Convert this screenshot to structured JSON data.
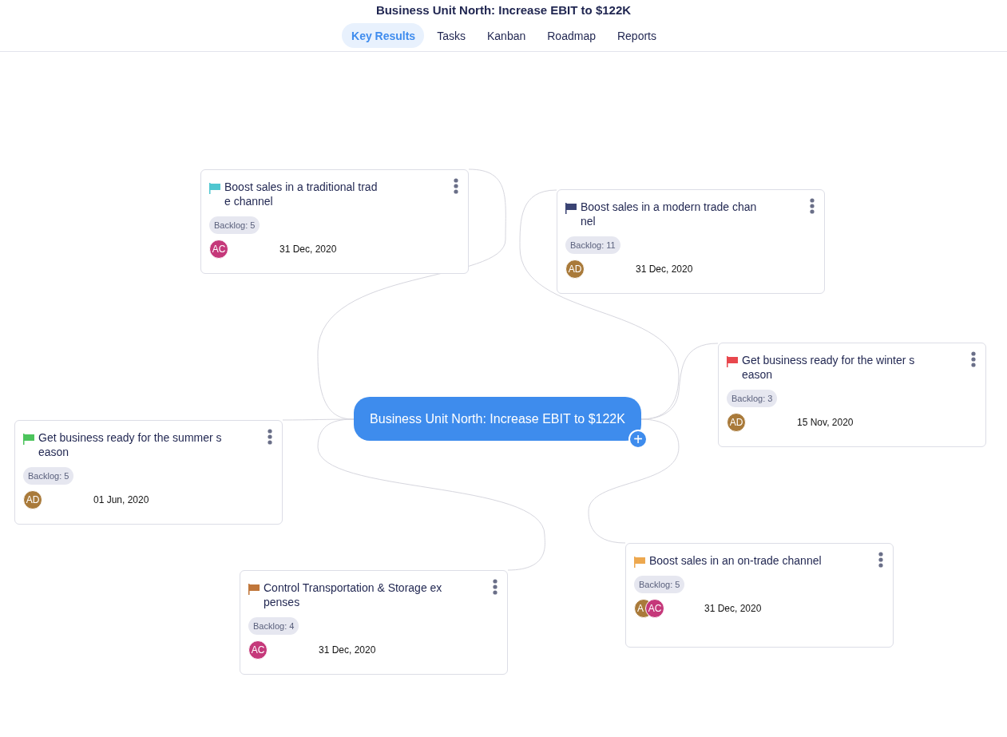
{
  "header": {
    "title": "Business Unit North: Increase EBIT to $122K"
  },
  "tabs": [
    {
      "label": "Key Results",
      "selected": true
    },
    {
      "label": "Tasks",
      "selected": false
    },
    {
      "label": "Kanban",
      "selected": false
    },
    {
      "label": "Roadmap",
      "selected": false
    },
    {
      "label": "Reports",
      "selected": false
    }
  ],
  "center_node": {
    "title": "Business Unit North: Increase EBIT to $122K",
    "add_button": "+"
  },
  "key_results": [
    {
      "title": "Boost sales in a traditional trade channel",
      "color": "#4fc6d0",
      "backlog": "Backlog: 5",
      "assignees": [
        {
          "initials": "AC",
          "color": "#c5387a"
        }
      ],
      "due": "31 Dec, 2020"
    },
    {
      "title": "Boost sales in a modern trade channel",
      "color": "#3a4373",
      "backlog": "Backlog: 11",
      "assignees": [
        {
          "initials": "AD",
          "color": "#a97a3a"
        }
      ],
      "due": "31 Dec, 2020"
    },
    {
      "title": "Get business ready for the winter season",
      "color": "#e8474d",
      "backlog": "Backlog: 3",
      "assignees": [
        {
          "initials": "AD",
          "color": "#a97a3a"
        }
      ],
      "due": "15 Nov, 2020"
    },
    {
      "title": "Get business ready for the summer season",
      "color": "#4cc45c",
      "backlog": "Backlog: 5",
      "assignees": [
        {
          "initials": "AD",
          "color": "#a97a3a"
        }
      ],
      "due": "01 Jun, 2020"
    },
    {
      "title": "Control Transportation & Storage expenses",
      "color": "#c0763a",
      "backlog": "Backlog: 4",
      "assignees": [
        {
          "initials": "AC",
          "color": "#c5387a"
        }
      ],
      "due": "31 Dec, 2020"
    },
    {
      "title": "Boost sales in an on-trade channel",
      "color": "#eda84f",
      "backlog": "Backlog: 5",
      "assignees": [
        {
          "initials": "A",
          "color": "#a97a3a"
        },
        {
          "initials": "AC",
          "color": "#c5387a"
        }
      ],
      "due": "31 Dec, 2020"
    }
  ]
}
